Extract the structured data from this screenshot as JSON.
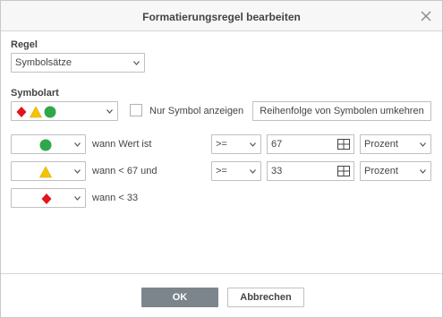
{
  "dialog": {
    "title": "Formatierungsregel bearbeiten",
    "close_icon": "close-icon"
  },
  "rule": {
    "label": "Regel",
    "selected": "Symbolsätze"
  },
  "icon_style": {
    "label": "Symbolart",
    "selected_icons": [
      "red-diamond",
      "yellow-triangle",
      "green-circle"
    ],
    "show_icon_only_label": "Nur Symbol anzeigen",
    "show_icon_only_checked": false,
    "reverse_button": "Reihenfolge von Symbolen umkehren"
  },
  "conditions": [
    {
      "icon": "green-circle",
      "text": "wann Wert ist",
      "operator": ">=",
      "value": "67",
      "type": "Prozent"
    },
    {
      "icon": "yellow-triangle",
      "text": "wann < 67 und",
      "operator": ">=",
      "value": "33",
      "type": "Prozent"
    },
    {
      "icon": "red-diamond",
      "text": "wann < 33"
    }
  ],
  "footer": {
    "ok": "OK",
    "cancel": "Abbrechen"
  },
  "colors": {
    "green": "#2ea84a",
    "yellow": "#f5c400",
    "red": "#e0161c",
    "ok_button": "#7d858c"
  }
}
